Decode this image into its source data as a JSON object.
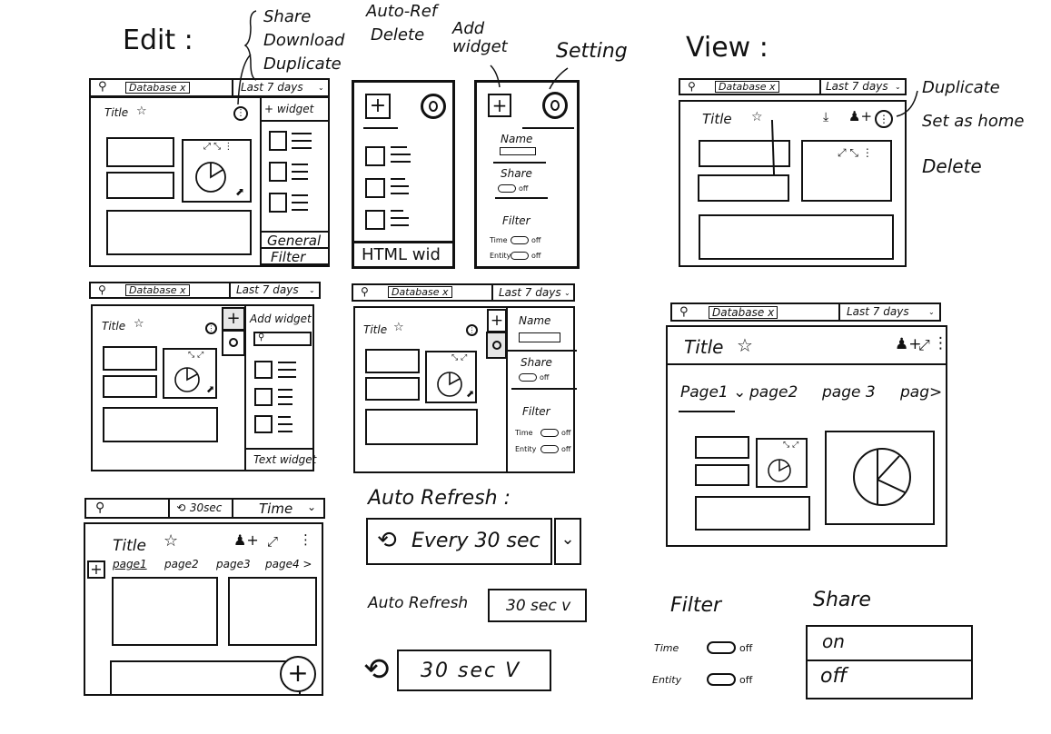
{
  "edit_section": {
    "heading": "Edit :",
    "annotations": {
      "menu_options": [
        "Share",
        "Download",
        "Duplicate"
      ],
      "more_options": [
        "Auto-Ref",
        "Delete"
      ],
      "add_widget": "Add widget",
      "setting": "Setting"
    },
    "filter_bar": {
      "search_icon": "search-icon",
      "chip": "Database x",
      "time_range": "Last 7 days"
    },
    "dashboard": {
      "title": "Title",
      "star_icon": "star-icon",
      "more_icon": "kebab-circle-icon"
    },
    "widget_sidebar": {
      "header": "+ widget",
      "tabs": [
        "General",
        "Filter"
      ]
    },
    "html_widget_panel": {
      "footer": "HTML wid"
    },
    "settings_panel": {
      "name_label": "Name",
      "share_label": "Share",
      "share_state": "off",
      "filter_label": "Filter",
      "time_label": "Time",
      "time_state": "off",
      "entity_label": "Entity",
      "entity_state": "off"
    },
    "add_widget_panel": {
      "header": "Add widget",
      "footer": "Text widget"
    }
  },
  "view_section": {
    "heading": "View :",
    "annotations": [
      "Duplicate",
      "Set as home",
      "Delete"
    ],
    "filter_bar": {
      "chip": "Database x",
      "time_range": "Last 7 days"
    },
    "dashboard": {
      "title": "Title"
    },
    "tabs": [
      "Page1 ⌄",
      "page2",
      "page 3",
      "pag>"
    ]
  },
  "mobile": {
    "refresh": "⟲ 30sec",
    "time": "Time",
    "title": "Title",
    "pages": [
      "page1",
      "page2",
      "page3",
      "page4 >"
    ]
  },
  "auto_refresh": {
    "heading": "Auto Refresh :",
    "option1_value": "Every 30 sec",
    "option2_label": "Auto Refresh",
    "option2_value": "30 sec v",
    "option3_value": "30 sec V"
  },
  "filter_component": {
    "label": "Filter",
    "time": "Time",
    "time_state": "off",
    "entity": "Entity",
    "entity_state": "off"
  },
  "share_component": {
    "label": "Share",
    "options": [
      "on",
      "off"
    ]
  }
}
